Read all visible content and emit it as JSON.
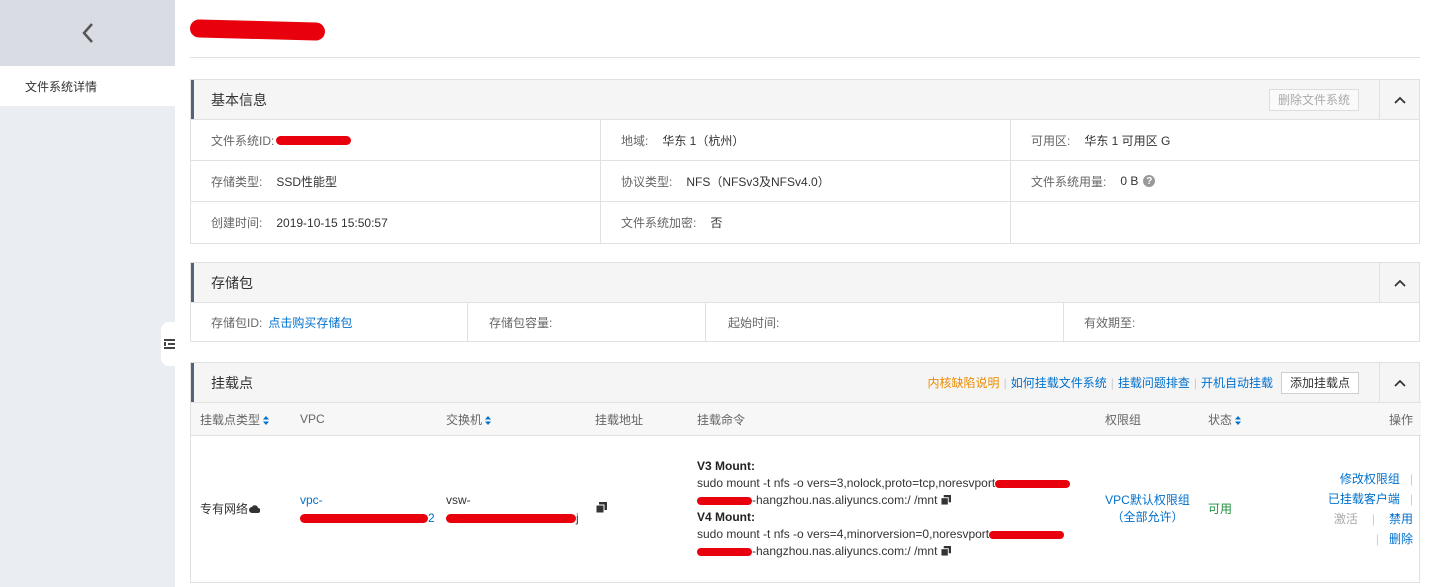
{
  "sidebar": {
    "back_icon": "chevron-left-icon",
    "items": [
      {
        "label": "文件系统详情"
      }
    ],
    "collapse_icon": "menu-collapse-icon"
  },
  "basic": {
    "title": "基本信息",
    "delete_button": "删除文件系统",
    "fields": {
      "fs_id_label": "文件系统ID:",
      "region_label": "地域:",
      "region_value": "华东 1（杭州）",
      "zone_label": "可用区:",
      "zone_value": "华东 1 可用区 G",
      "storage_type_label": "存储类型:",
      "storage_type_value": "SSD性能型",
      "protocol_label": "协议类型:",
      "protocol_value": "NFS（NFSv3及NFSv4.0）",
      "usage_label": "文件系统用量:",
      "usage_value": "0 B",
      "created_label": "创建时间:",
      "created_value": "2019-10-15 15:50:57",
      "encrypt_label": "文件系统加密:",
      "encrypt_value": "否"
    }
  },
  "package": {
    "title": "存储包",
    "id_label": "存储包ID:",
    "id_link": "点击购买存储包",
    "capacity_label": "存储包容量:",
    "start_label": "起始时间:",
    "expire_label": "有效期至:"
  },
  "mount": {
    "title": "挂载点",
    "links": {
      "kernel_bug": "内核缺陷说明",
      "how_to_mount": "如何挂载文件系统",
      "troubleshoot": "挂载问题排查",
      "auto_mount": "开机自动挂载"
    },
    "add_button": "添加挂载点",
    "columns": {
      "type": "挂载点类型",
      "vpc": "VPC",
      "vswitch": "交换机",
      "address": "挂载地址",
      "command": "挂载命令",
      "permission": "权限组",
      "status": "状态",
      "ops": "操作"
    },
    "row": {
      "type": "专有网络",
      "vpc": "vpc-",
      "vpc_tail": "2",
      "vswitch": "vsw-",
      "vswitch_tail": "j",
      "v3_title": "V3 Mount:",
      "v3_line1": "sudo mount -t nfs -o vers=3,nolock,proto=tcp,noresvport",
      "v3_line2": "-hangzhou.nas.aliyuncs.com:/ /mnt",
      "v4_title": "V4 Mount:",
      "v4_line1": "sudo mount -t nfs -o vers=4,minorversion=0,noresvport",
      "v4_line2": "-hangzhou.nas.aliyuncs.com:/ /mnt",
      "permission_line1": "VPC默认权限组",
      "permission_line2": "（全部允许）",
      "status": "可用",
      "op_modify": "修改权限组",
      "op_clients": "已挂载客户端",
      "op_activate": "激活",
      "op_disable": "禁用",
      "op_delete": "删除",
      "pipe": "|"
    }
  },
  "colors": {
    "link": "#0070cc",
    "warning_link": "#ee8c00",
    "status_ok": "#1e8e3e",
    "redaction": "#e8000d"
  }
}
